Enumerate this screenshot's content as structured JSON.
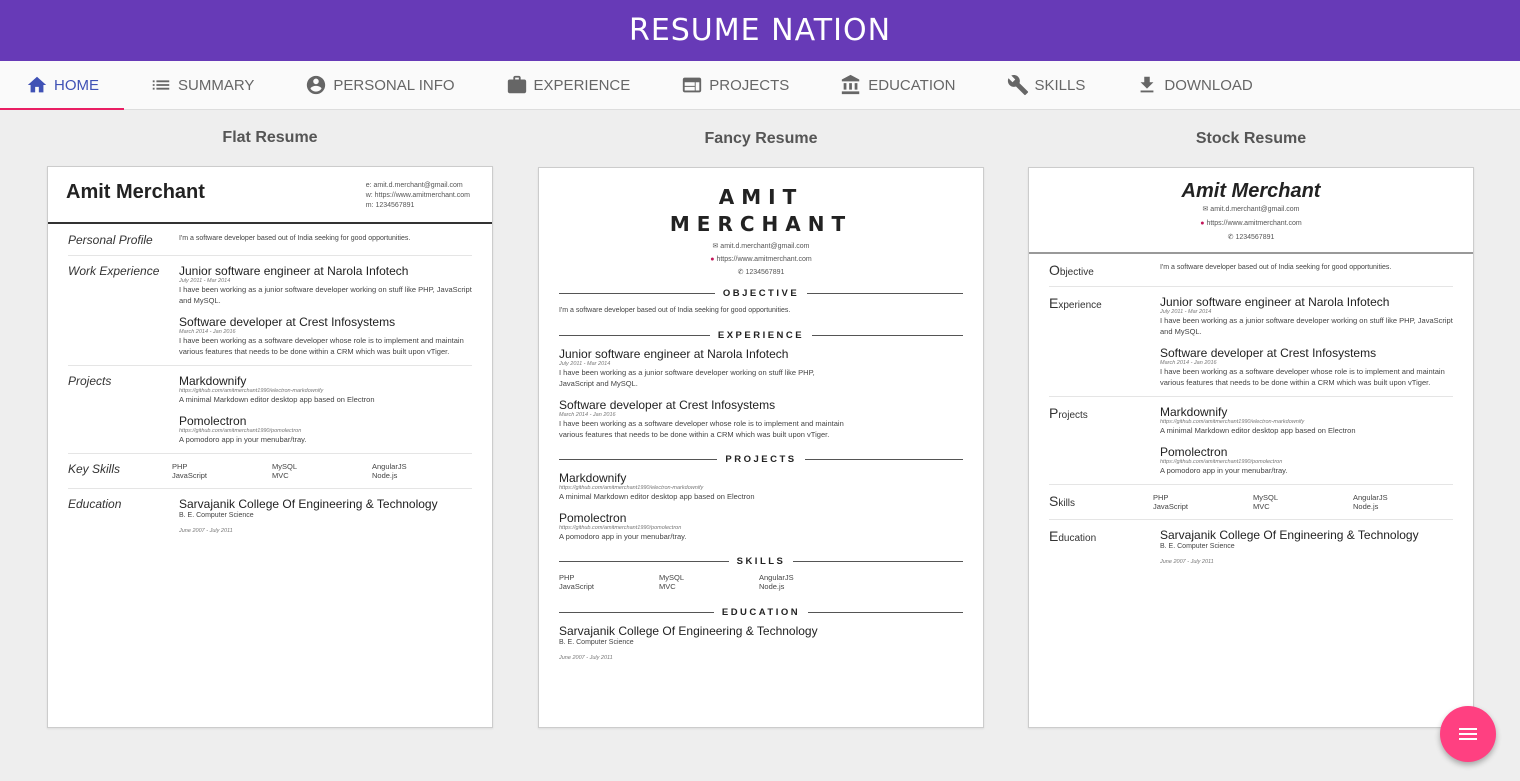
{
  "app": {
    "brand": "RESUME NATION"
  },
  "tabs": [
    {
      "label": "HOME",
      "icon": "home-icon",
      "active": true
    },
    {
      "label": "SUMMARY",
      "icon": "list-icon"
    },
    {
      "label": "PERSONAL INFO",
      "icon": "account-circle-icon"
    },
    {
      "label": "EXPERIENCE",
      "icon": "briefcase-icon"
    },
    {
      "label": "PROJECTS",
      "icon": "web-icon"
    },
    {
      "label": "EDUCATION",
      "icon": "institution-icon"
    },
    {
      "label": "SKILLS",
      "icon": "wrench-icon"
    },
    {
      "label": "DOWNLOAD",
      "icon": "download-icon"
    }
  ],
  "templates": {
    "flat": "Flat Resume",
    "fancy": "Fancy Resume",
    "stock": "Stock Resume"
  },
  "resume": {
    "name": "Amit Merchant",
    "fancy_name_line1": "AMIT",
    "fancy_name_line2": "MERCHANT",
    "email": "amit.d.merchant@gmail.com",
    "website": "https://www.amitmerchant.com",
    "phone": "1234567891",
    "flat_email": "e: amit.d.merchant@gmail.com",
    "flat_website": "w: https://www.amitmerchant.com",
    "flat_phone": "m: 1234567891",
    "profile": "I'm a software developer based out of India seeking for good opportunities.",
    "jobs": [
      {
        "title": "Junior software engineer at Narola Infotech",
        "dates": "July 2011 - Mar 2014",
        "desc": "I have been working as a junior software developer working on stuff like PHP, JavaScript and MySQL."
      },
      {
        "title": "Software developer at Crest Infosystems",
        "dates": "March 2014 - Jan 2016",
        "desc": "I have been working as a software developer whose role is to implement and maintain various features that needs to be done within a CRM which was built upon vTiger."
      }
    ],
    "projects": [
      {
        "name": "Markdownify",
        "url": "https://github.com/amitmerchant1990/electron-markdownify",
        "desc": "A minimal Markdown editor desktop app based on Electron"
      },
      {
        "name": "Pomolectron",
        "url": "https://github.com/amitmerchant1990/pomolectron",
        "desc": "A pomodoro app in your menubar/tray."
      }
    ],
    "skills": [
      "PHP",
      "MySQL",
      "AngularJS",
      "JavaScript",
      "MVC",
      "Node.js"
    ],
    "education": {
      "school": "Sarvajanik College Of Engineering & Technology",
      "degree": "B. E. Computer Science",
      "dates": "June 2007 - July 2011"
    }
  },
  "labels": {
    "flat": {
      "profile": "Personal Profile",
      "work": "Work Experience",
      "projects": "Projects",
      "skills": "Key Skills",
      "education": "Education"
    },
    "fancy": {
      "objective": "OBJECTIVE",
      "experience": "EXPERIENCE",
      "projects": "PROJECTS",
      "skills": "SKILLS",
      "education": "EDUCATION"
    },
    "stock": {
      "objective": {
        "initial": "O",
        "rest": "bjective"
      },
      "experience": {
        "initial": "E",
        "rest": "xperience"
      },
      "projects": {
        "initial": "P",
        "rest": "rojects"
      },
      "skills": {
        "initial": "S",
        "rest": "kills"
      },
      "education": {
        "initial": "E",
        "rest": "ducation"
      }
    }
  },
  "colors": {
    "topbar": "#673ab7",
    "active_tab": "#3f51b5",
    "tab_indicator": "#e91e63",
    "fab": "#ff4081"
  },
  "fab": {
    "icon": "menu-icon"
  }
}
